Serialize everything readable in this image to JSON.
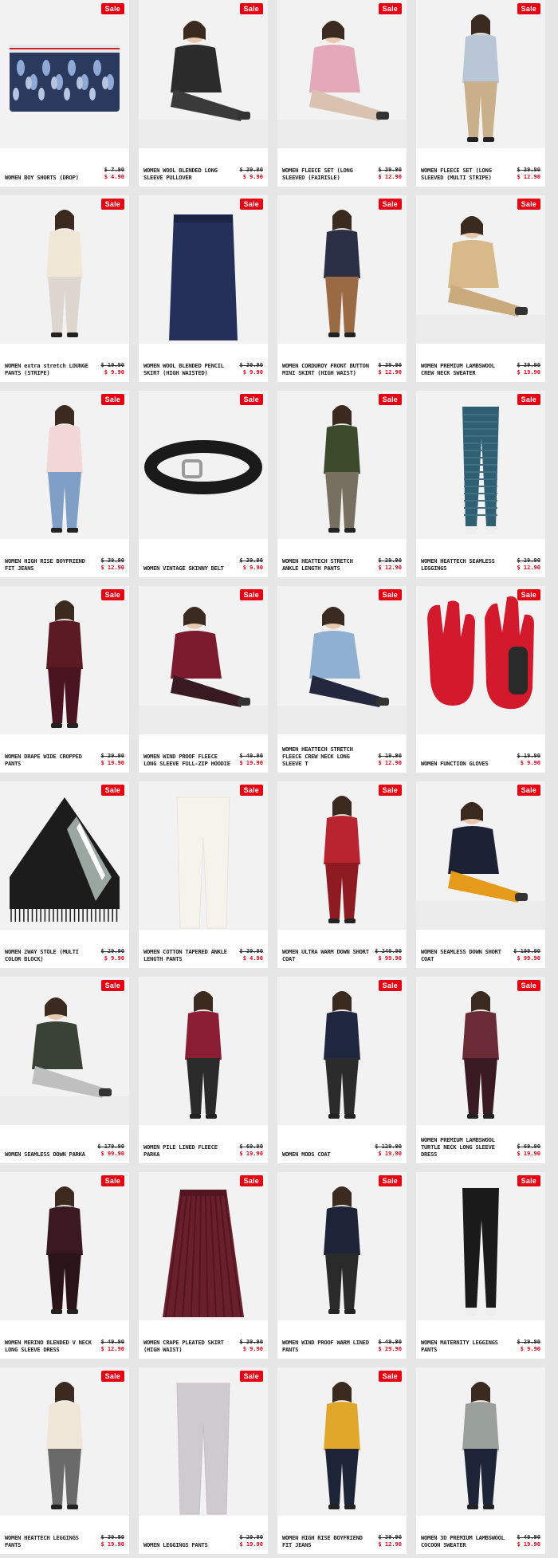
{
  "badge_label": "Sale",
  "colors": {
    "accent": "#e60012",
    "card_bg": "#f3f3f3",
    "page_bg": "#e6e6e6"
  },
  "products": [
    {
      "name": "WOMEN BOY SHORTS (DROP)",
      "old": "$ 7.90",
      "new": "$ 4.90",
      "sale": true,
      "art": "shorts",
      "c1": "#2a3a5e",
      "c2": "#8fa8d4"
    },
    {
      "name": "WOMEN WOOL BLENDED LONG SLEEVE PULLOVER",
      "old": "$ 39.90",
      "new": "$ 9.90",
      "sale": true,
      "art": "model-sit",
      "c1": "#2b2b2b",
      "c2": "#3a3a3a"
    },
    {
      "name": "WOMEN FLEECE SET (LONG SLEEVED (FAIRISLE)",
      "old": "$ 39.90",
      "new": "$ 12.90",
      "sale": true,
      "art": "model-sit",
      "c1": "#e4a9b8",
      "c2": "#d9c2b0"
    },
    {
      "name": "WOMEN FLEECE SET (LONG SLEEVED (MULTI STRIPE)",
      "old": "$ 39.90",
      "new": "$ 12.90",
      "sale": true,
      "art": "model-stand",
      "c1": "#b9c6d6",
      "c2": "#c9b08a"
    },
    {
      "name": "WOMEN extra stretch LOUNGE PANTS (STRIPE)",
      "old": "$ 19.90",
      "new": "$ 9.90",
      "sale": true,
      "art": "model-stand",
      "c1": "#f1e7d6",
      "c2": "#dcd6cf"
    },
    {
      "name": "WOMEN WOOL BLENDED PENCIL SKIRT (HIGH WAISTED)",
      "old": "$ 39.90",
      "new": "$ 9.90",
      "sale": true,
      "art": "skirt",
      "c1": "#24305a",
      "c2": "#1b2445"
    },
    {
      "name": "WOMEN CORDUROY FRONT BUTTON MINI SKIRT (HIGH WAIST)",
      "old": "$ 39.90",
      "new": "$ 12.90",
      "sale": true,
      "art": "model-stand",
      "c1": "#2b2f45",
      "c2": "#9a6a45"
    },
    {
      "name": "WOMEN PREMIUM LAMBSWOOL CREW NECK SWEATER",
      "old": "$ 39.90",
      "new": "$ 19.90",
      "sale": true,
      "art": "model-sit",
      "c1": "#d8b98a",
      "c2": "#c9ab7e"
    },
    {
      "name": "WOMEN HIGH RISE BOYFRIEND FIT JEANS",
      "old": "$ 39.90",
      "new": "$ 12.90",
      "sale": true,
      "art": "model-stand",
      "c1": "#f2d7d7",
      "c2": "#7f9fc6"
    },
    {
      "name": "WOMEN VINTAGE SKINNY BELT",
      "old": "$ 39.90",
      "new": "$ 9.90",
      "sale": true,
      "art": "belt",
      "c1": "#1a1a1a",
      "c2": "#9a9a9a"
    },
    {
      "name": "WOMEN HEATTECH STRETCH ANKLE LENGTH PANTS",
      "old": "$ 29.90",
      "new": "$ 12.90",
      "sale": true,
      "art": "model-stand",
      "c1": "#3b4a2a",
      "c2": "#777060"
    },
    {
      "name": "WOMEN HEATTECH SEAMLESS LEGGINGS",
      "old": "$ 29.90",
      "new": "$ 12.90",
      "sale": true,
      "art": "leggings",
      "c1": "#2f5f73",
      "c2": "#2a5566"
    },
    {
      "name": "WOMEN DRAPE WIDE CROPPED PANTS",
      "old": "$ 39.90",
      "new": "$ 19.90",
      "sale": true,
      "art": "model-stand",
      "c1": "#5c1a24",
      "c2": "#4a1520"
    },
    {
      "name": "WOMEN WIND PROOF FLEECE LONG SLEEVE FULL-ZIP HOODIE",
      "old": "$ 49.90",
      "new": "$ 19.90",
      "sale": true,
      "art": "model-sit",
      "c1": "#7a1a2c",
      "c2": "#3a1a22"
    },
    {
      "name": "WOMEN HEATTECH STRETCH FLEECE CREW NECK LONG SLEEVE T",
      "old": "$ 19.90",
      "new": "$ 12.90",
      "sale": true,
      "art": "model-sit",
      "c1": "#8fb0d0",
      "c2": "#24283e"
    },
    {
      "name": "WOMEN FUNCTION GLOVES",
      "old": "$ 19.90",
      "new": "$ 9.90",
      "sale": true,
      "art": "gloves",
      "c1": "#d3192c",
      "c2": "#2a2a2a"
    },
    {
      "name": "WOMEN 2WAY STOLE (MULTI COLOR BLOCK)",
      "old": "$ 29.90",
      "new": "$ 9.90",
      "sale": true,
      "art": "stole",
      "c1": "#1c1c1c",
      "c2": "#9aa6a0"
    },
    {
      "name": "WOMEN COTTON TAPERED ANKLE LENGTH PANTS",
      "old": "$ 39.90",
      "new": "$ 4.90",
      "sale": true,
      "art": "pants",
      "c1": "#f6f3ec",
      "c2": "#e9e4da"
    },
    {
      "name": "WOMEN ULTRA WARM DOWN SHORT COAT",
      "old": "$ 249.90",
      "new": "$ 99.90",
      "sale": true,
      "art": "model-stand",
      "c1": "#b8242f",
      "c2": "#8e1a22"
    },
    {
      "name": "WOMEN SEAMLESS DOWN SHORT COAT",
      "old": "$ 199.90",
      "new": "$ 99.90",
      "sale": true,
      "art": "model-sit",
      "c1": "#1c2233",
      "c2": "#e59a1a"
    },
    {
      "name": "WOMEN SEAMLESS DOWN PARKA",
      "old": "$ 179.90",
      "new": "$ 99.90",
      "sale": true,
      "art": "model-sit",
      "c1": "#3a4236",
      "c2": "#bfbfbf"
    },
    {
      "name": "WOMEN PILE LINED FLEECE PARKA",
      "old": "$ 69.90",
      "new": "$ 19.90",
      "sale": false,
      "art": "model-stand",
      "c1": "#8a1f33",
      "c2": "#2a2a2a"
    },
    {
      "name": "WOMEN MODS COAT",
      "old": "$ 129.90",
      "new": "$ 19.90",
      "sale": true,
      "art": "model-stand",
      "c1": "#1e2640",
      "c2": "#2b2b2b"
    },
    {
      "name": "WOMEN PREMIUM LAMBSWOOL TURTLE NECK LONG SLEEVE DRESS",
      "old": "$ 69.90",
      "new": "$ 19.90",
      "sale": true,
      "art": "model-stand",
      "c1": "#6a2a36",
      "c2": "#3a1a22"
    },
    {
      "name": "WOMEN MERINO BLENDED V NECK LONG SLEEVE DRESS",
      "old": "$ 49.90",
      "new": "$ 12.90",
      "sale": true,
      "art": "model-stand",
      "c1": "#3a1a20",
      "c2": "#2a1418"
    },
    {
      "name": "WOMEN CRAPE PLEATED SKIRT (HIGH WAIST)",
      "old": "$ 39.90",
      "new": "$ 9.90",
      "sale": true,
      "art": "pleated",
      "c1": "#6a1f2c",
      "c2": "#521620"
    },
    {
      "name": "WOMEN WIND PROOF WARM LINED PANTS",
      "old": "$ 49.90",
      "new": "$ 29.90",
      "sale": true,
      "art": "model-stand",
      "c1": "#1e2438",
      "c2": "#2a2a2a"
    },
    {
      "name": "WOMEN MATERNITY LEGGINGS PANTS",
      "old": "$ 29.90",
      "new": "$ 9.90",
      "sale": true,
      "art": "leggings",
      "c1": "#1a1a1a",
      "c2": "#111111"
    },
    {
      "name": "WOMEN HEATTECH LEGGINGS PANTS",
      "old": "$ 39.90",
      "new": "$ 19.90",
      "sale": true,
      "art": "model-stand",
      "c1": "#efe6d8",
      "c2": "#6a6a6a"
    },
    {
      "name": "WOMEN LEGGINGS PANTS",
      "old": "$ 29.90",
      "new": "$ 19.90",
      "sale": true,
      "art": "pants",
      "c1": "#cfcace",
      "c2": "#c4bfc3"
    },
    {
      "name": "WOMEN HIGH RISE BOYFRIEND FIT JEANS",
      "old": "$ 39.90",
      "new": "$ 12.90",
      "sale": true,
      "art": "model-stand",
      "c1": "#e0a72a",
      "c2": "#1e2438"
    },
    {
      "name": "WOMEN 3D PREMIUM LAMBSWOOL COCOON SWEATER",
      "old": "$ 49.90",
      "new": "$ 19.90",
      "sale": false,
      "art": "model-stand",
      "c1": "#9aa09a",
      "c2": "#1e2438"
    }
  ]
}
